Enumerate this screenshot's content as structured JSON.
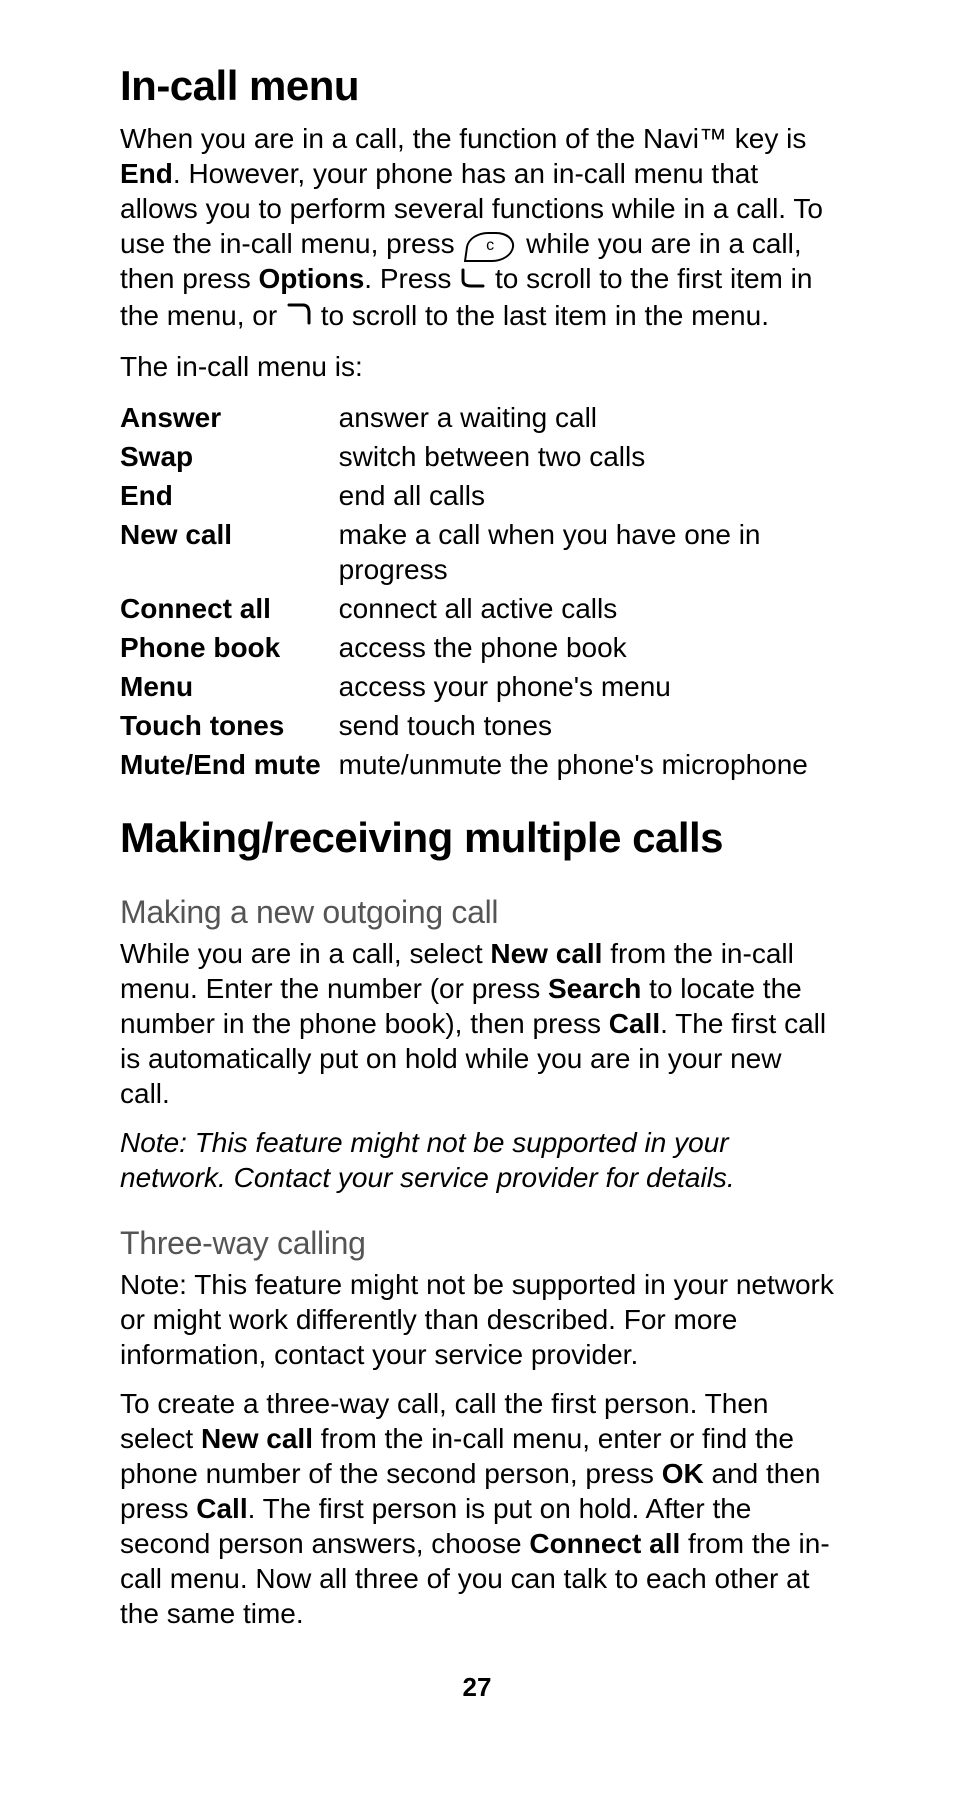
{
  "section1": {
    "heading": "In-call menu",
    "intro_part1": "When you are in a call, the  function of the Navi™ key  is ",
    "intro_end": "End",
    "intro_part2": ". However, your phone has an in-call menu that allows you to perform several functions while in a call. To use the in-call menu, press ",
    "intro_part3": " while you are in a call, then press ",
    "intro_options": "Options",
    "intro_part4": ". Press ",
    "intro_part5": " to scroll to the first item in the menu, or ",
    "intro_part6": " to scroll to the last item in the menu.",
    "lead": "The in-call menu is:",
    "items": [
      {
        "term": "Answer",
        "desc": "answer a waiting call"
      },
      {
        "term": "Swap",
        "desc": "switch between two calls"
      },
      {
        "term": "End",
        "desc": "end all calls"
      },
      {
        "term": "New call",
        "desc": "make a call when you have one in progress"
      },
      {
        "term": "Connect all",
        "desc": "connect all active calls"
      },
      {
        "term": "Phone book",
        "desc": "access the phone book"
      },
      {
        "term": "Menu",
        "desc": "access your phone's menu"
      },
      {
        "term": "Touch tones",
        "desc": "send touch tones"
      },
      {
        "term": "Mute/End mute",
        "desc": "mute/unmute the phone's microphone"
      }
    ]
  },
  "section2": {
    "heading": "Making/receiving multiple calls",
    "sub1": {
      "heading": "Making a new outgoing call",
      "p1a": "While you are in a call, select ",
      "p1_newcall": "New call",
      "p1b": " from the in-call menu. Enter the number (or press ",
      "p1_search": "Search",
      "p1c": " to locate the number in the phone book), then press ",
      "p1_call": "Call",
      "p1d": ". The first call is automatically put on hold while you are in your new call.",
      "note": "Note:  This feature might not be supported in your network. Contact your service provider for details."
    },
    "sub2": {
      "heading": "Three-way calling",
      "p1": "Note:  This feature might not be supported in your network or might work differently than described. For more information, contact your service provider.",
      "p2a": "To create a three-way call, call the first person. Then select ",
      "p2_newcall": "New call",
      "p2b": " from the in-call menu, enter or find the phone number of the second person, press ",
      "p2_ok": "OK",
      "p2c": " and then press ",
      "p2_call": "Call",
      "p2d": ". The first person is put on hold. After the second person answers, choose ",
      "p2_connect": "Connect all",
      "p2e": " from the in-call menu. Now all three of you can talk to each other at the same time."
    }
  },
  "page_number": "27"
}
